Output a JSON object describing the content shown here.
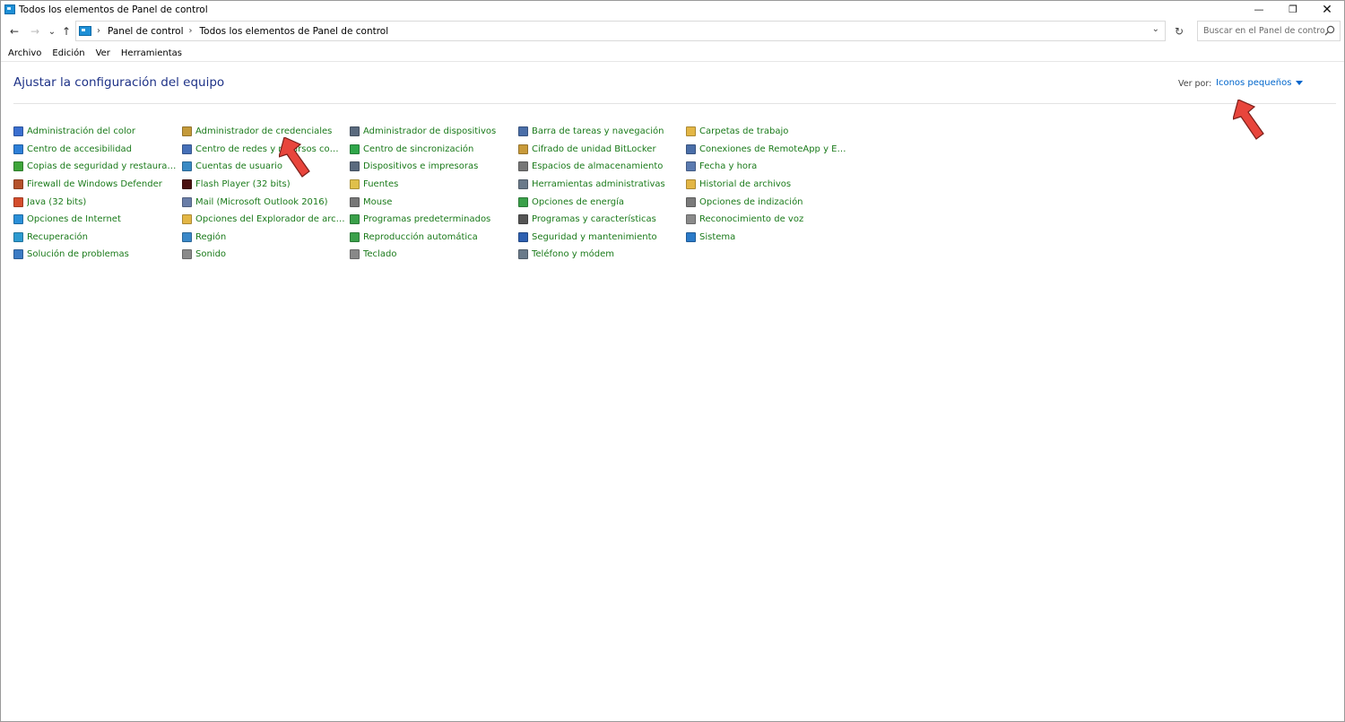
{
  "window": {
    "title": "Todos los elementos de Panel de control",
    "minimize_glyph": "—",
    "restore_glyph": "❐",
    "close_glyph": "✕"
  },
  "nav": {
    "back_glyph": "←",
    "forward_glyph": "→",
    "recent_glyph": "⌄",
    "up_glyph": "↑",
    "refresh_glyph": "↻",
    "breadcrumb": [
      "Panel de control",
      "Todos los elementos de Panel de control"
    ],
    "sep_glyph": "›",
    "dropdown_glyph": "⌄",
    "search_placeholder": "Buscar en el Panel de control"
  },
  "menu": [
    "Archivo",
    "Edición",
    "Ver",
    "Herramientas"
  ],
  "header": {
    "title": "Ajustar la configuración del equipo",
    "view_by_label": "Ver por:",
    "view_by_value": "Iconos pequeños"
  },
  "colors": {
    "link_green": "#1a7a1a",
    "link_blue": "#0066cc",
    "title_blue": "#1e3287",
    "arrow_red": "#e8453c"
  },
  "items": [
    {
      "label": "Administración del color",
      "icon": "color-management-icon",
      "color": "#3a6fd0"
    },
    {
      "label": "Centro de accesibilidad",
      "icon": "accessibility-icon",
      "color": "#2d7fd8"
    },
    {
      "label": "Copias de seguridad y restauración (...",
      "icon": "backup-icon",
      "color": "#3ea53a"
    },
    {
      "label": "Firewall de Windows Defender",
      "icon": "firewall-icon",
      "color": "#b5522b"
    },
    {
      "label": "Java (32 bits)",
      "icon": "java-icon",
      "color": "#d44d2c"
    },
    {
      "label": "Opciones de Internet",
      "icon": "internet-options-icon",
      "color": "#2a8fd8"
    },
    {
      "label": "Recuperación",
      "icon": "recovery-icon",
      "color": "#2d9ad0"
    },
    {
      "label": "Solución de problemas",
      "icon": "troubleshooting-icon",
      "color": "#3b7bc4"
    },
    {
      "label": "Administrador de credenciales",
      "icon": "credential-manager-icon",
      "color": "#c49a3a"
    },
    {
      "label": "Centro de redes y recursos comparti...",
      "icon": "network-center-icon",
      "color": "#4670b8"
    },
    {
      "label": "Cuentas de usuario",
      "icon": "user-accounts-icon",
      "color": "#3a8ac4"
    },
    {
      "label": "Flash Player (32 bits)",
      "icon": "flash-player-icon",
      "color": "#4a1111"
    },
    {
      "label": "Mail (Microsoft Outlook 2016)",
      "icon": "mail-icon",
      "color": "#6a7ea8"
    },
    {
      "label": "Opciones del Explorador de archivos",
      "icon": "folder-options-icon",
      "color": "#e3b645"
    },
    {
      "label": "Región",
      "icon": "region-icon",
      "color": "#3a88c8"
    },
    {
      "label": "Sonido",
      "icon": "sound-icon",
      "color": "#8a8a8a"
    },
    {
      "label": "Administrador de dispositivos",
      "icon": "device-manager-icon",
      "color": "#5a6a7e"
    },
    {
      "label": "Centro de sincronización",
      "icon": "sync-center-icon",
      "color": "#2fa64a"
    },
    {
      "label": "Dispositivos e impresoras",
      "icon": "devices-printers-icon",
      "color": "#5a6a7e"
    },
    {
      "label": "Fuentes",
      "icon": "fonts-icon",
      "color": "#e0c04a"
    },
    {
      "label": "Mouse",
      "icon": "mouse-icon",
      "color": "#777777"
    },
    {
      "label": "Programas predeterminados",
      "icon": "default-programs-icon",
      "color": "#3aa04a"
    },
    {
      "label": "Reproducción automática",
      "icon": "autoplay-icon",
      "color": "#3aa04a"
    },
    {
      "label": "Teclado",
      "icon": "keyboard-icon",
      "color": "#888888"
    },
    {
      "label": "Barra de tareas y navegación",
      "icon": "taskbar-icon",
      "color": "#4a6ea8"
    },
    {
      "label": "Cifrado de unidad BitLocker",
      "icon": "bitlocker-icon",
      "color": "#c89a3a"
    },
    {
      "label": "Espacios de almacenamiento",
      "icon": "storage-spaces-icon",
      "color": "#777777"
    },
    {
      "label": "Herramientas administrativas",
      "icon": "admin-tools-icon",
      "color": "#6a7a8a"
    },
    {
      "label": "Opciones de energía",
      "icon": "power-options-icon",
      "color": "#3aa04a"
    },
    {
      "label": "Programas y características",
      "icon": "programs-features-icon",
      "color": "#555555"
    },
    {
      "label": "Seguridad y mantenimiento",
      "icon": "security-maintenance-icon",
      "color": "#2d5fb0"
    },
    {
      "label": "Teléfono y módem",
      "icon": "phone-modem-icon",
      "color": "#6a7a8a"
    },
    {
      "label": "Carpetas de trabajo",
      "icon": "work-folders-icon",
      "color": "#e3b645"
    },
    {
      "label": "Conexiones de RemoteApp y Escrito...",
      "icon": "remoteapp-icon",
      "color": "#4a6ea8"
    },
    {
      "label": "Fecha y hora",
      "icon": "date-time-icon",
      "color": "#5a7ab0"
    },
    {
      "label": "Historial de archivos",
      "icon": "file-history-icon",
      "color": "#e3b645"
    },
    {
      "label": "Opciones de indización",
      "icon": "indexing-options-icon",
      "color": "#7a7a7a"
    },
    {
      "label": "Reconocimiento de voz",
      "icon": "speech-recognition-icon",
      "color": "#8a8a8a"
    },
    {
      "label": "Sistema",
      "icon": "system-icon",
      "color": "#2a7ac8"
    }
  ]
}
